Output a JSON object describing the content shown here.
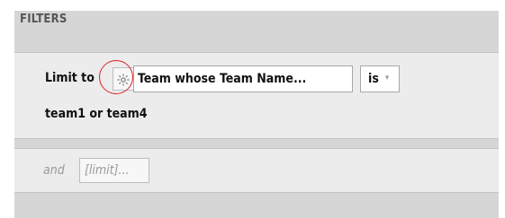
{
  "panel": {
    "title": "FILTERS"
  },
  "filter": {
    "prefix_label": "Limit to",
    "gear_icon": "gear-icon",
    "field_label": "Team whose Team Name...",
    "operator_label": "is",
    "operator_caret": "▾",
    "value_text": "team1 or team4"
  },
  "add_filter": {
    "and_label": "and",
    "placeholder_label": "[limit]..."
  },
  "colors": {
    "panel_bg": "#d6d6d6",
    "row_bg": "#ececec",
    "highlight": "#dd2222"
  }
}
